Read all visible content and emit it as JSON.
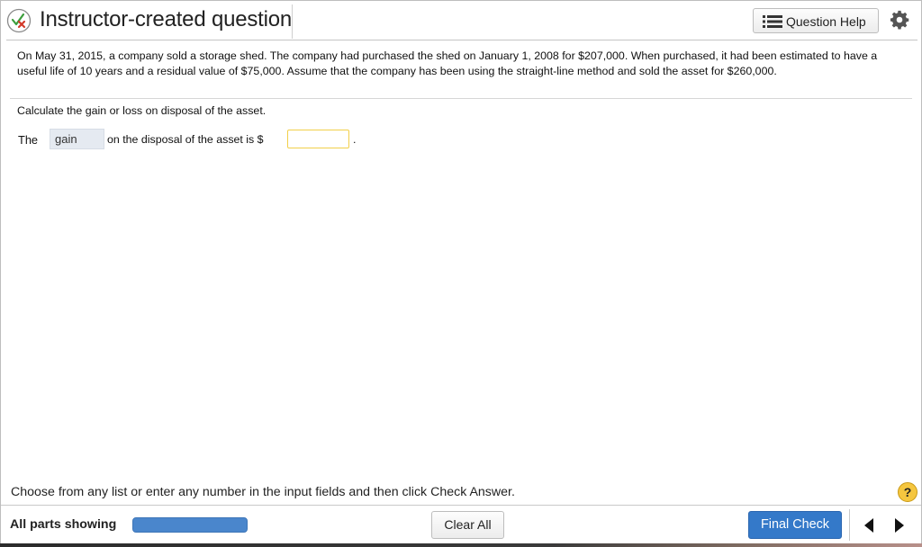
{
  "header": {
    "title": "Instructor-created question",
    "help_label": "Question Help",
    "icons": [
      "check-x-icon",
      "list-icon",
      "gear-icon"
    ]
  },
  "problem": {
    "text": "On May 31, 2015, a company sold a storage shed.  The company had purchased the shed on January 1, 2008 for $207,000.  When purchased, it had been estimated to have a useful life of 10 years and a residual value of $75,000.  Assume that the company has been using the straight-line method and sold the asset for $260,000."
  },
  "question": {
    "instruction": "Calculate the gain or loss on disposal of the asset.",
    "prefix": "The",
    "gain_loss_selected": "gain",
    "middle": "on the disposal of the asset is $",
    "amount_value": "",
    "suffix": "."
  },
  "footer": {
    "message": "Choose from any list or enter any number in the input fields and then click Check Answer.",
    "help_symbol": "?",
    "parts_label": "All parts showing",
    "progress": 1.0,
    "clear_label": "Clear All",
    "final_label": "Final Check"
  },
  "colors": {
    "primary_blue": "#3479c9",
    "progress_blue": "#4a86cc",
    "input_border": "#f2cf4a",
    "help_yellow": "#f5c63f",
    "select_bg": "#e5eaf1"
  }
}
